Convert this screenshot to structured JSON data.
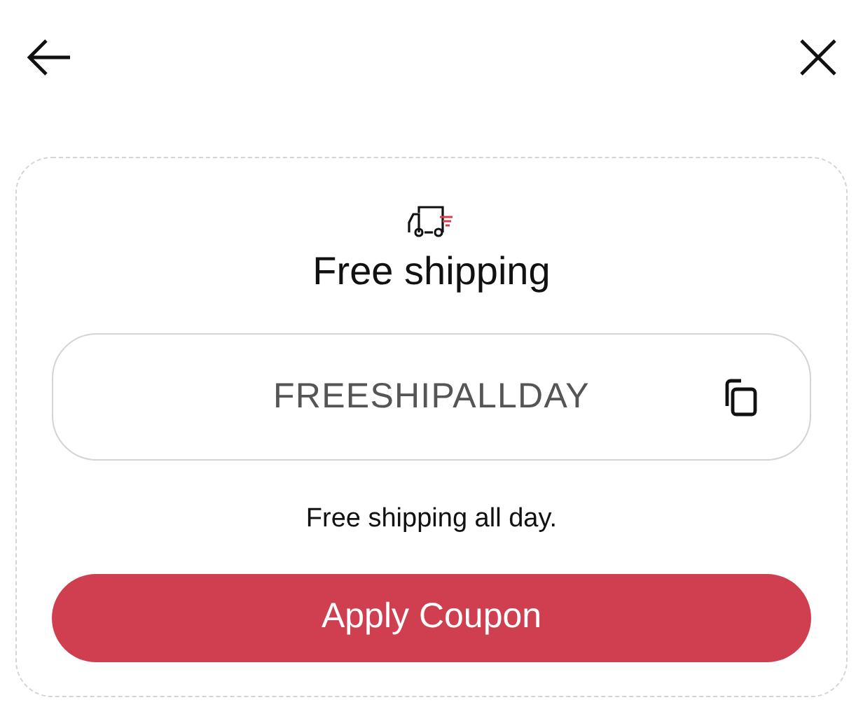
{
  "title": "Free shipping",
  "coupon": {
    "code": "FREESHIPALLDAY"
  },
  "description": "Free shipping all day.",
  "button": "Apply Coupon"
}
